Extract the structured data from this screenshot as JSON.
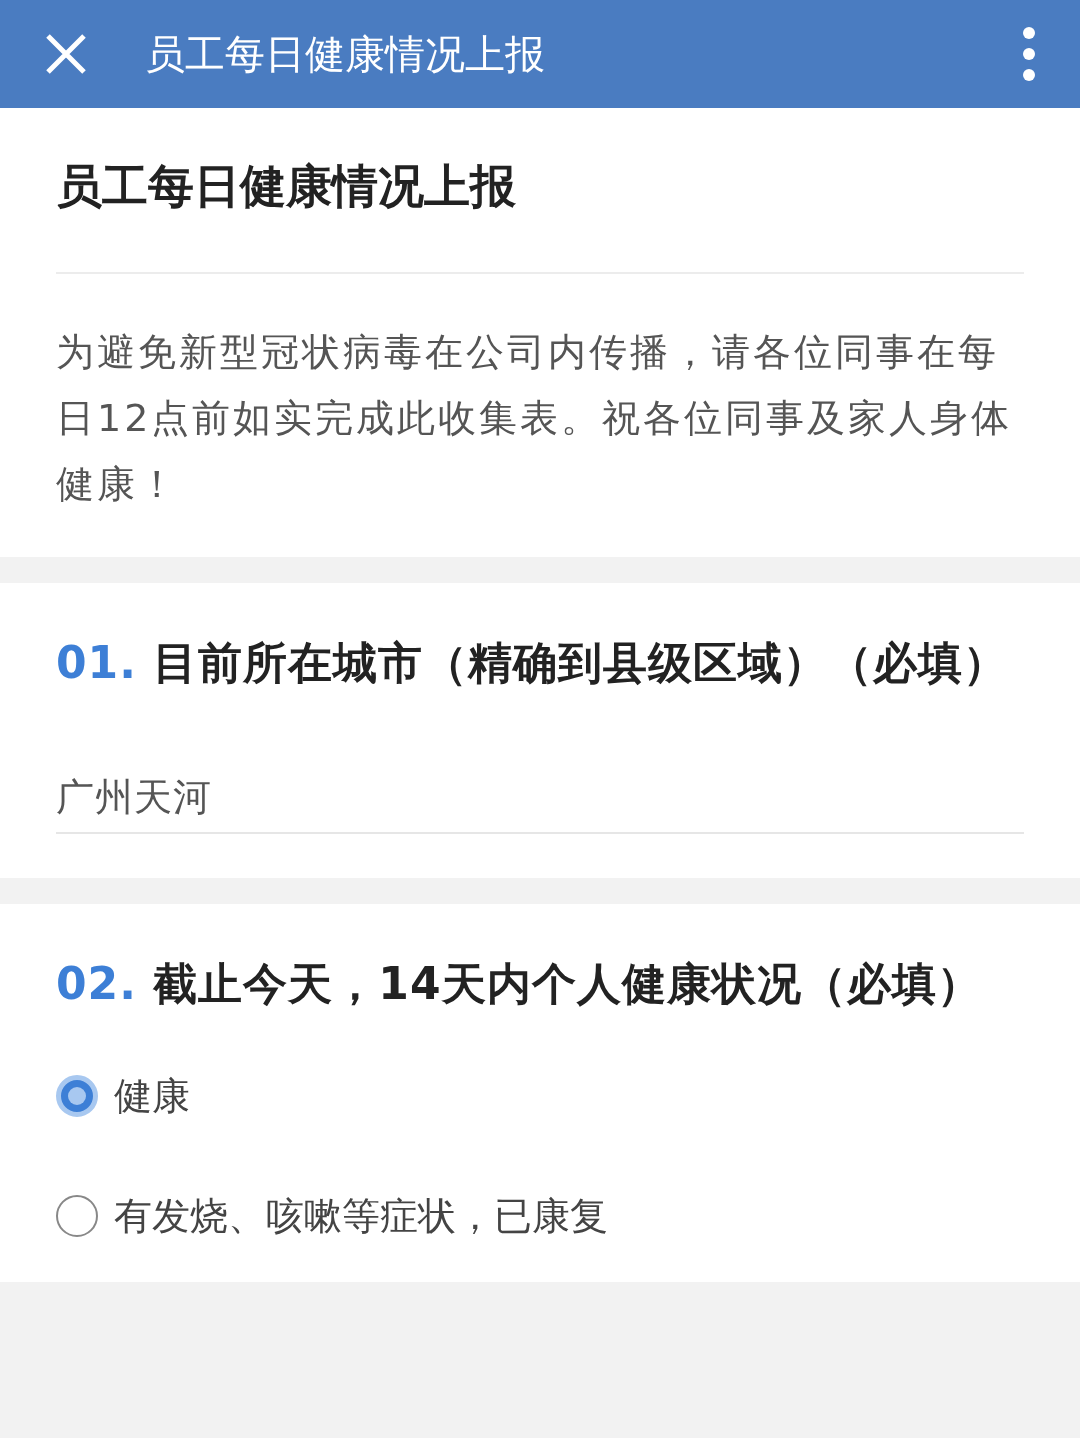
{
  "header": {
    "title": "员工每日健康情况上报"
  },
  "form": {
    "title": "员工每日健康情况上报",
    "description": "为避免新型冠状病毒在公司内传播，请各位同事在每日12点前如实完成此收集表。祝各位同事及家人身体健康！"
  },
  "questions": [
    {
      "kind": "text",
      "number": "01.",
      "title": "目前所在城市（精确到县级区域）（必填）",
      "value": "广州天河"
    },
    {
      "kind": "radio",
      "number": "02.",
      "title": "截止今天，14天内个人健康状况（必填）",
      "options": [
        {
          "label": "健康",
          "selected": true
        },
        {
          "label": "有发烧、咳嗽等症状，已康复",
          "selected": false
        }
      ]
    }
  ]
}
